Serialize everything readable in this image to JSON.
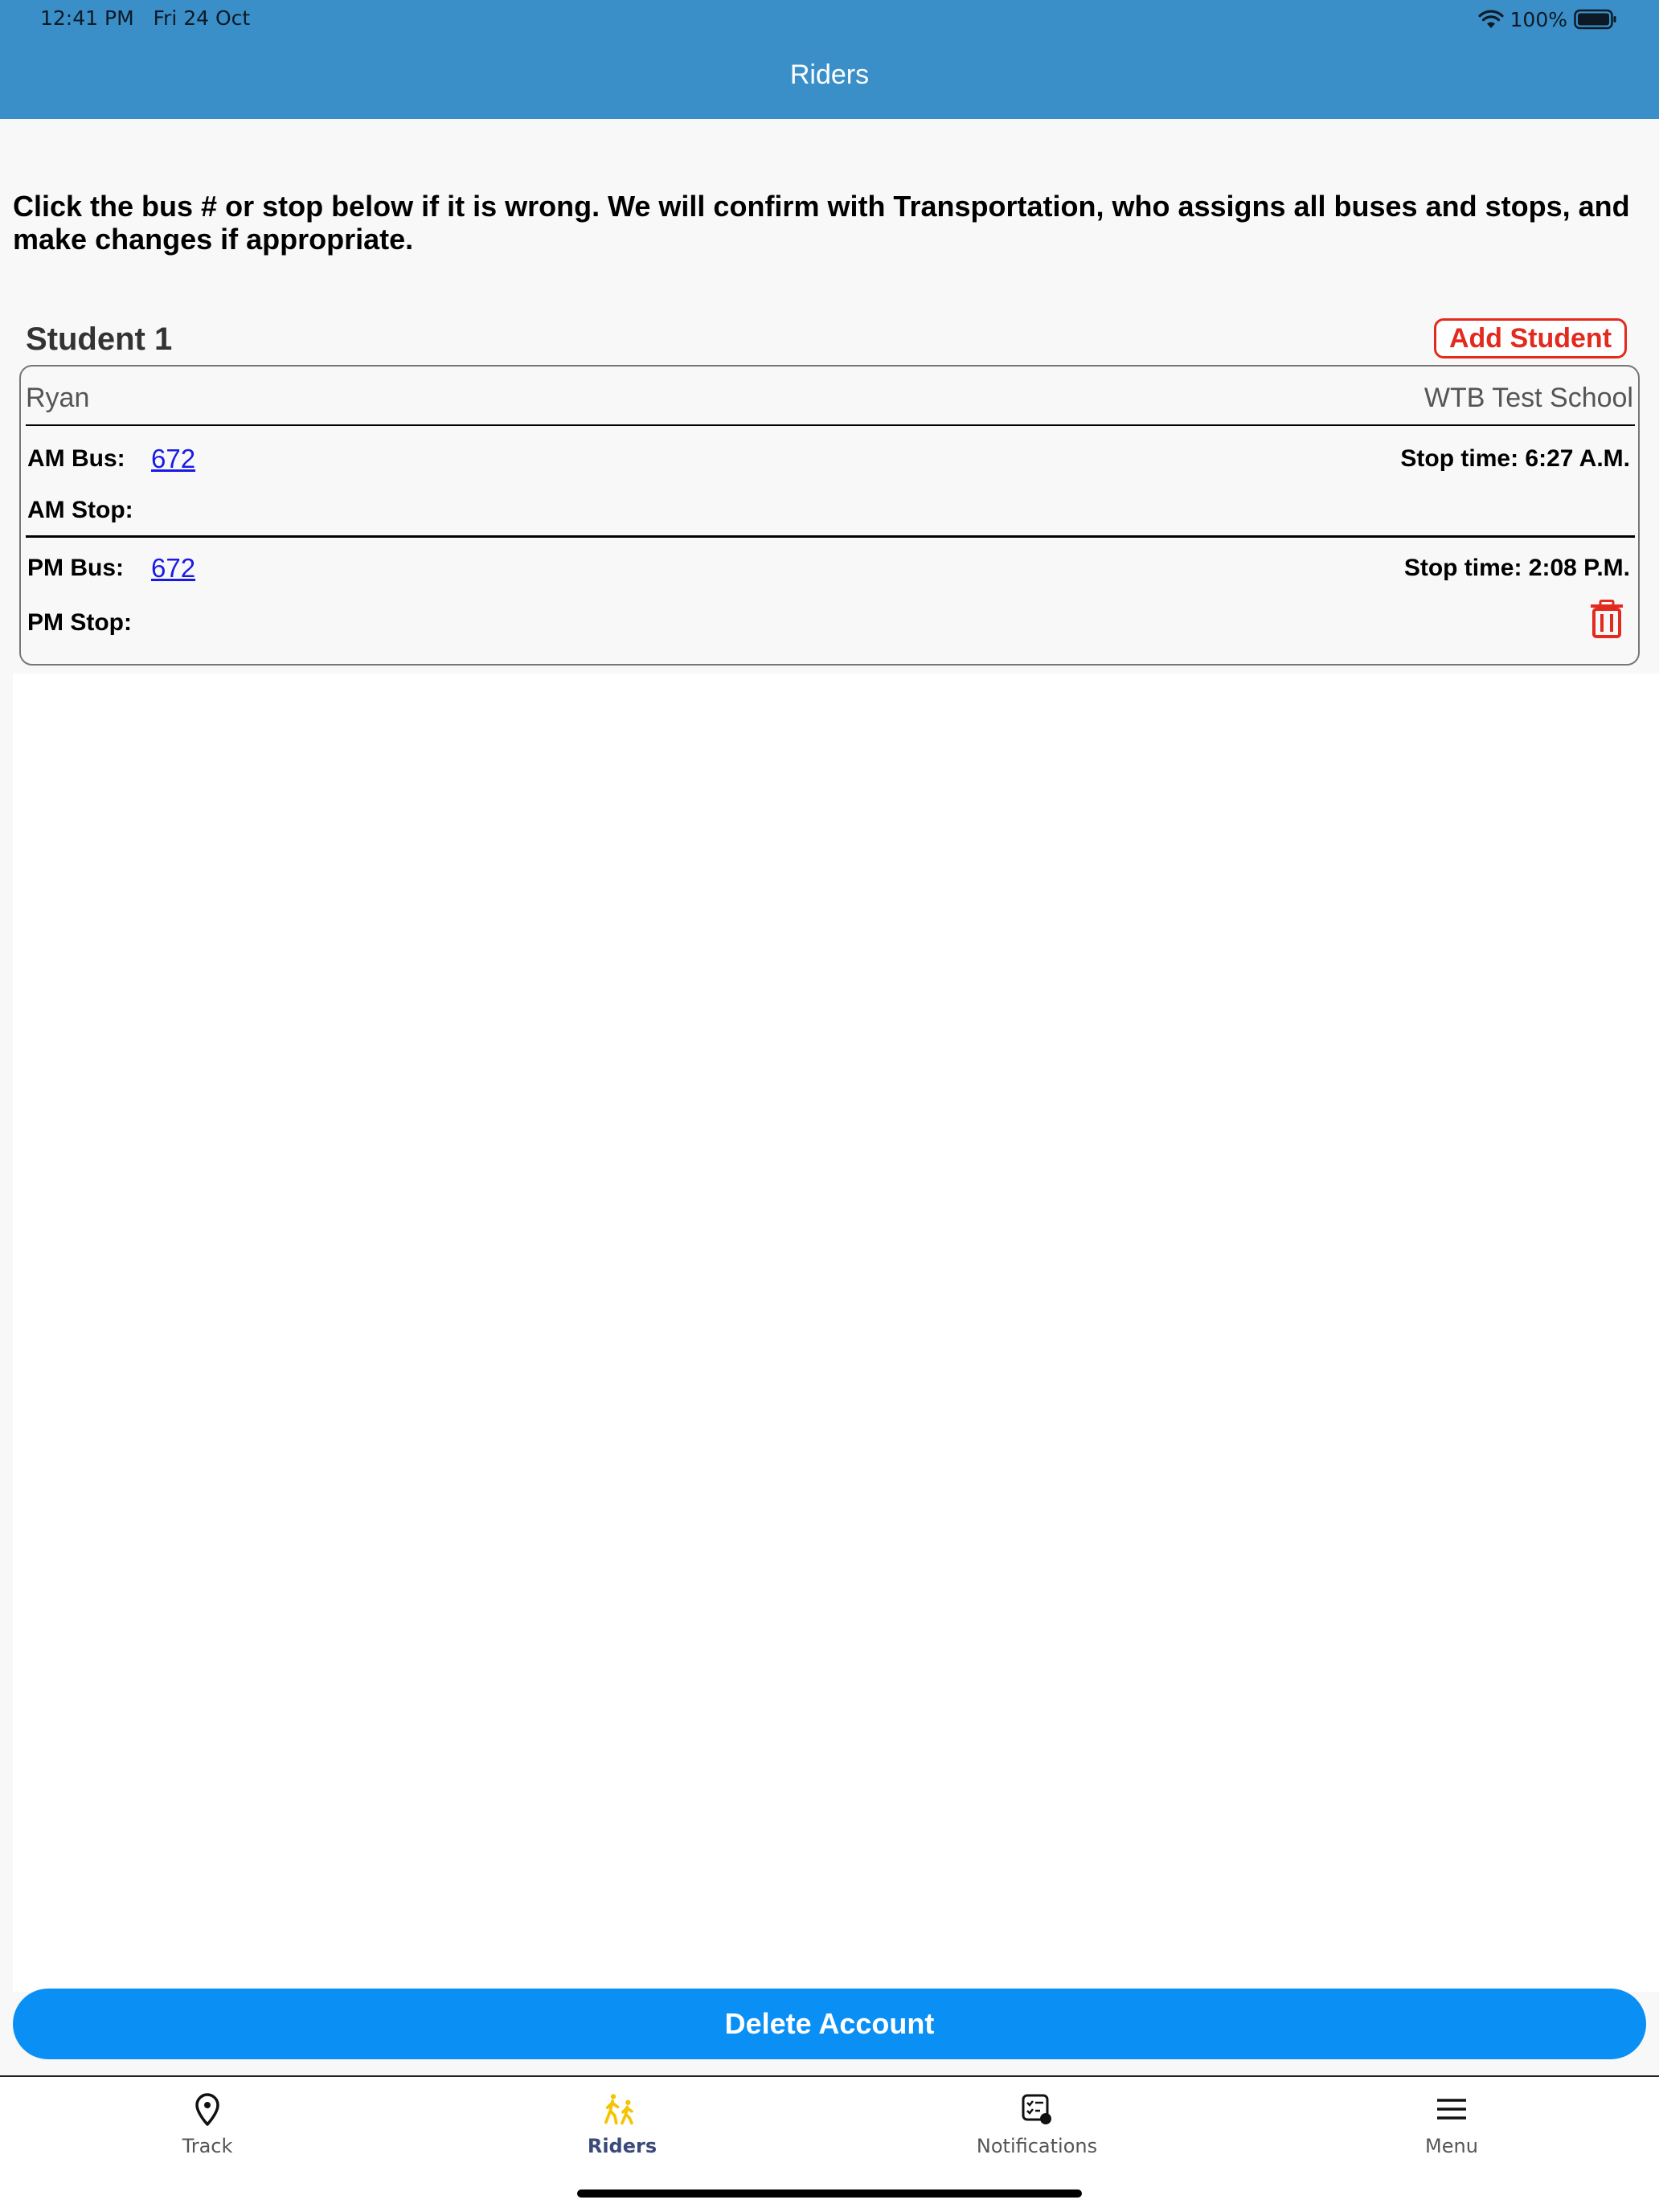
{
  "status_bar": {
    "time": "12:41 PM",
    "date": "Fri 24 Oct",
    "battery": "100%"
  },
  "header": {
    "title": "Riders"
  },
  "intro_text": "Click the bus # or stop below if it is wrong. We will confirm with Transportation, who assigns all buses and stops, and make changes if appropriate.",
  "student": {
    "heading": "Student 1",
    "add_button": "Add Student",
    "name": "Ryan",
    "school": "WTB Test School",
    "am_bus_label": "AM Bus:",
    "am_bus": "672",
    "am_stop_time": "Stop time: 6:27 A.M.",
    "am_stop_label": "AM Stop:",
    "pm_bus_label": "PM Bus:",
    "pm_bus": "672",
    "pm_stop_time": "Stop time: 2:08 P.M.",
    "pm_stop_label": "PM Stop:"
  },
  "delete_button": "Delete Account",
  "tabs": [
    {
      "label": "Track",
      "icon": "location-pin-icon",
      "active": false
    },
    {
      "label": "Riders",
      "icon": "walking-students-icon",
      "active": true
    },
    {
      "label": "Notifications",
      "icon": "notifications-icon",
      "active": false
    },
    {
      "label": "Menu",
      "icon": "hamburger-menu-icon",
      "active": false
    }
  ],
  "colors": {
    "header": "#3a8fc8",
    "accent_red": "#e32a1e",
    "link_blue": "#1a1ae8",
    "delete_button": "#0a8ff5",
    "active_tab_icon": "#f5c400"
  }
}
